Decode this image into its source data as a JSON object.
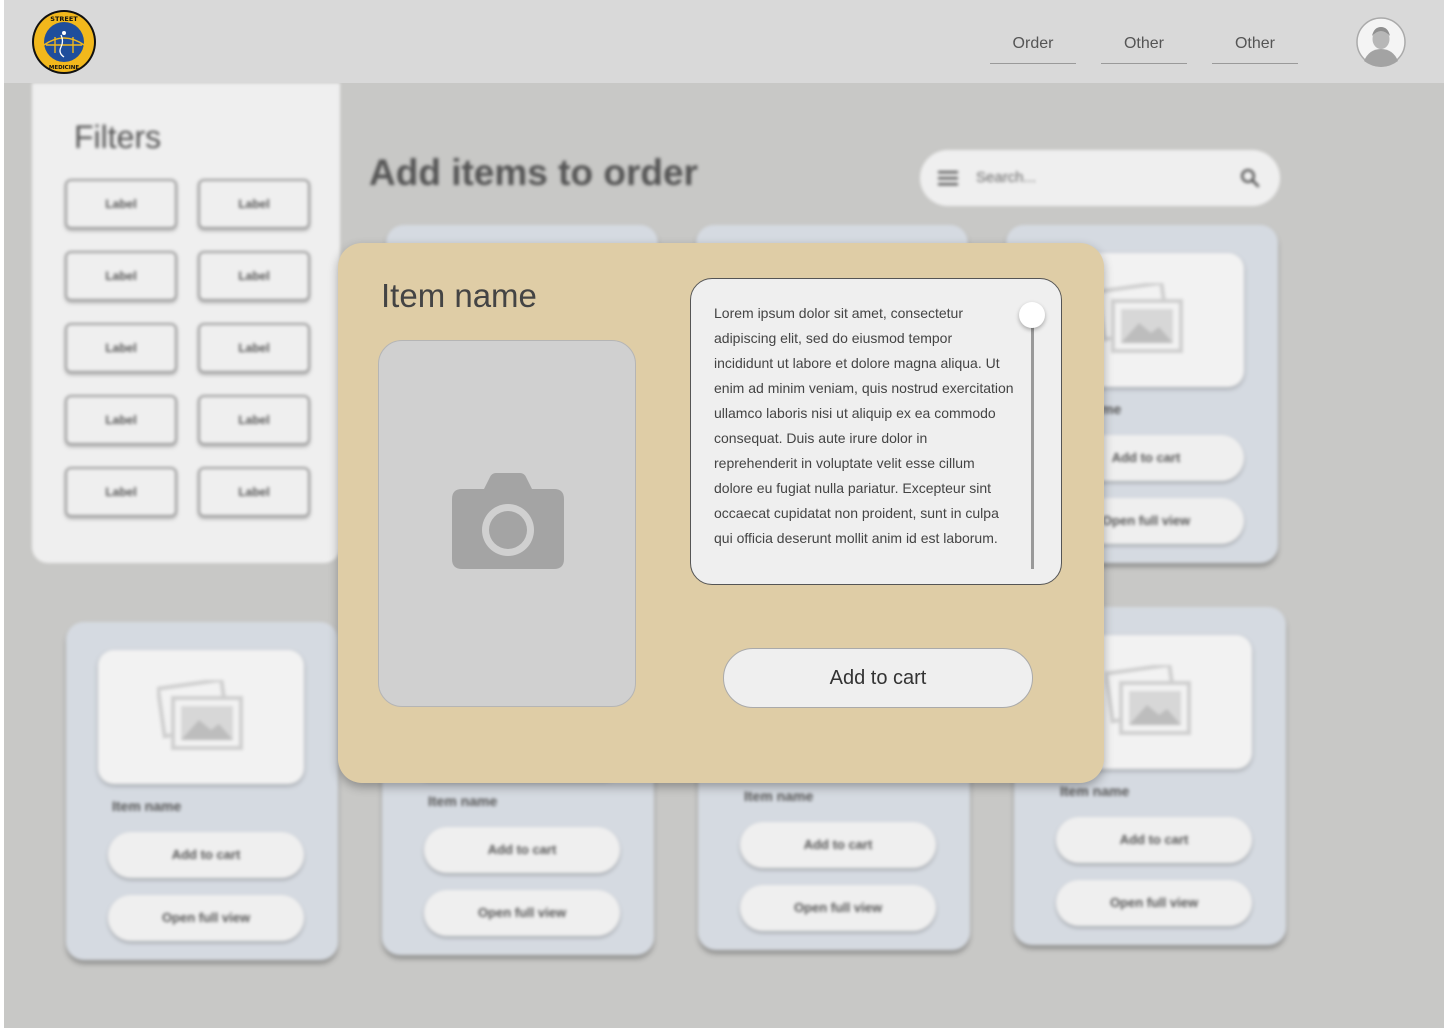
{
  "nav": {
    "items": [
      {
        "label": "Order"
      },
      {
        "label": "Other"
      },
      {
        "label": "Other"
      }
    ]
  },
  "logo": {
    "top_text": "STREET",
    "bottom_text": "MEDICINE"
  },
  "filters": {
    "title": "Filters",
    "chips": [
      "Label",
      "Label",
      "Label",
      "Label",
      "Label",
      "Label",
      "Label",
      "Label",
      "Label",
      "Label"
    ]
  },
  "main": {
    "title": "Add items to order",
    "search_placeholder": "Search..."
  },
  "cards": [
    {
      "name": "Item name",
      "add_label": "Add to cart",
      "view_label": "Open full view"
    },
    {
      "name": "Item name",
      "add_label": "Add to cart",
      "view_label": "Open full view"
    },
    {
      "name": "Item name",
      "add_label": "Add to cart",
      "view_label": "Open full view"
    },
    {
      "name": "Item name",
      "add_label": "Add to cart",
      "view_label": "Open full view"
    },
    {
      "name": "Item name",
      "add_label": "Add to cart",
      "view_label": "Open full view"
    },
    {
      "name": "Item name",
      "add_label": "Add to cart",
      "view_label": "Open full view"
    },
    {
      "name": "Item name",
      "add_label": "Add to cart",
      "view_label": "Open full view"
    },
    {
      "name": "Item name",
      "add_label": "Add to cart",
      "view_label": "Open full view"
    }
  ],
  "modal": {
    "title": "Item name",
    "description": "Lorem ipsum dolor sit amet, consectetur adipiscing elit, sed do eiusmod tempor incididunt ut labore et dolore magna aliqua. Ut enim ad minim veniam, quis nostrud exercitation ullamco laboris nisi ut aliquip ex ea commodo consequat. Duis aute irure dolor in reprehenderit in voluptate velit esse cillum dolore eu fugiat nulla pariatur. Excepteur sint occaecat cupidatat non proident, sunt in culpa qui officia deserunt mollit anim id est laborum.",
    "add_button": "Add to cart"
  },
  "colors": {
    "background": "#c8c8c6",
    "topbar": "#d9d9d9",
    "card": "#d5dae1",
    "modal": "#dfcda6",
    "logo_blue": "#1f4e9c",
    "logo_gold": "#f2b81c"
  },
  "icons": [
    "street-medicine-logo",
    "user-avatar-icon",
    "menu-icon",
    "search-icon",
    "image-placeholder-icon",
    "camera-icon"
  ]
}
